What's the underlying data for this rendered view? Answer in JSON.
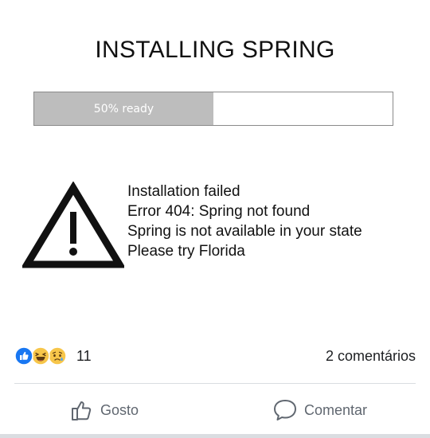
{
  "post": {
    "title": "INSTALLING SPRING",
    "progress": {
      "label": "50% ready",
      "fraction": 0.5
    },
    "error": {
      "lines": [
        "Installation failed",
        "Error 404:  Spring not found",
        "Spring is not available in your state",
        "Please try Florida"
      ],
      "icon": "warning-triangle-icon"
    }
  },
  "reactions": {
    "icons": [
      "like-reaction-icon",
      "haha-reaction-icon",
      "sad-reaction-icon"
    ],
    "count": "11",
    "comments": "2 comentários"
  },
  "actions": {
    "like_label": "Gosto",
    "comment_label": "Comentar"
  },
  "colors": {
    "like_blue": "#1877f2",
    "emoji_yellow": "#f7c64a",
    "action_gray": "#606770",
    "progress_fill": "#bdbdbd"
  }
}
